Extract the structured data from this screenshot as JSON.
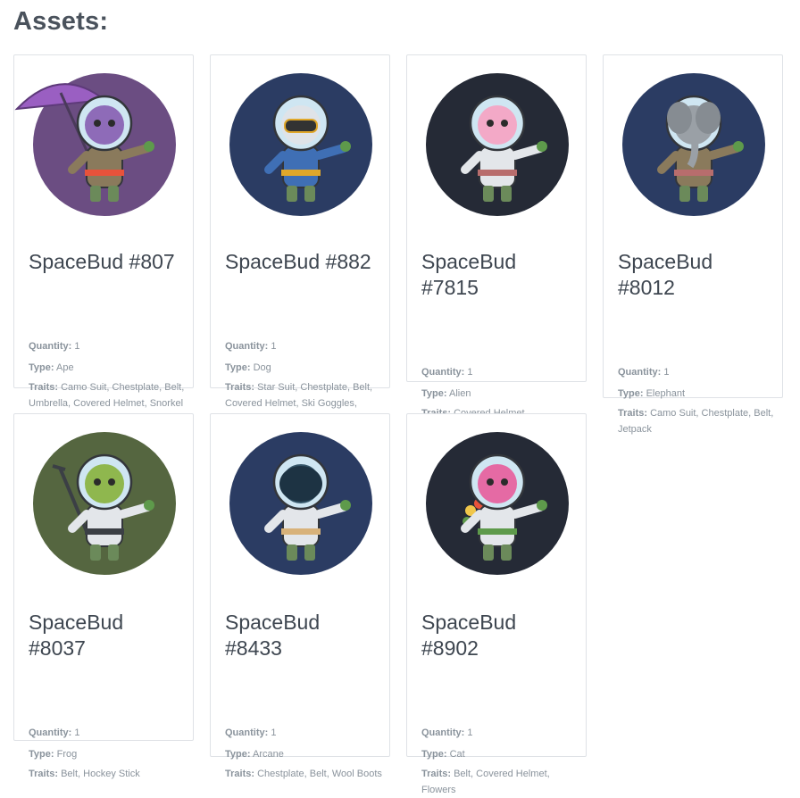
{
  "page": {
    "title": "Assets:"
  },
  "labels": {
    "quantity": "Quantity:",
    "type": "Type:",
    "traits": "Traits:"
  },
  "assets": [
    {
      "name": "SpaceBud #807",
      "quantity": "1",
      "type": "Ape",
      "traits": "Camo Suit, Chestplate, Belt, Umbrella, Covered Helmet, Snorkel",
      "bg": "#6b4d82",
      "head": "#8e6bb8",
      "suit": "#8a7a5c",
      "accent": "#e8523b",
      "prop": "umbrella",
      "icon": "ape-astronaut-icon"
    },
    {
      "name": "SpaceBud #882",
      "quantity": "1",
      "type": "Dog",
      "traits": "Star Suit, Chestplate, Belt, Covered Helmet, Ski Goggles, Watch",
      "bg": "#2b3c63",
      "head": "#dfe3e8",
      "suit": "#3f6fb5",
      "accent": "#e0a72a",
      "prop": "goggles",
      "icon": "dog-astronaut-icon"
    },
    {
      "name": "SpaceBud #7815",
      "quantity": "1",
      "type": "Alien",
      "traits": "Covered Helmet",
      "bg": "#252a36",
      "head": "#f3a9c7",
      "suit": "#e3e6ea",
      "accent": "#b86d6d",
      "prop": "none",
      "icon": "alien-astronaut-icon"
    },
    {
      "name": "SpaceBud #8012",
      "quantity": "1",
      "type": "Elephant",
      "traits": "Camo Suit, Chestplate, Belt, Jetpack",
      "bg": "#2b3c63",
      "head": "#9aa0a6",
      "suit": "#8a7a5c",
      "accent": "#b86d6d",
      "prop": "trunk",
      "icon": "elephant-astronaut-icon"
    },
    {
      "name": "SpaceBud #8037",
      "quantity": "1",
      "type": "Frog",
      "traits": "Belt, Hockey Stick",
      "bg": "#556640",
      "head": "#8fb74e",
      "suit": "#e3e6ea",
      "accent": "#3b3f45",
      "prop": "hockey",
      "icon": "frog-astronaut-icon"
    },
    {
      "name": "SpaceBud #8433",
      "quantity": "1",
      "type": "Arcane",
      "traits": "Chestplate, Belt, Wool Boots",
      "bg": "#2b3c63",
      "head": "#355568",
      "suit": "#e3e6ea",
      "accent": "#d8b27a",
      "prop": "visor",
      "icon": "arcane-astronaut-icon"
    },
    {
      "name": "SpaceBud #8902",
      "quantity": "1",
      "type": "Cat",
      "traits": "Belt, Covered Helmet, Flowers",
      "bg": "#252a36",
      "head": "#e56aa4",
      "suit": "#e3e6ea",
      "accent": "#5e9a4b",
      "prop": "flowers",
      "icon": "cat-astronaut-icon"
    }
  ]
}
